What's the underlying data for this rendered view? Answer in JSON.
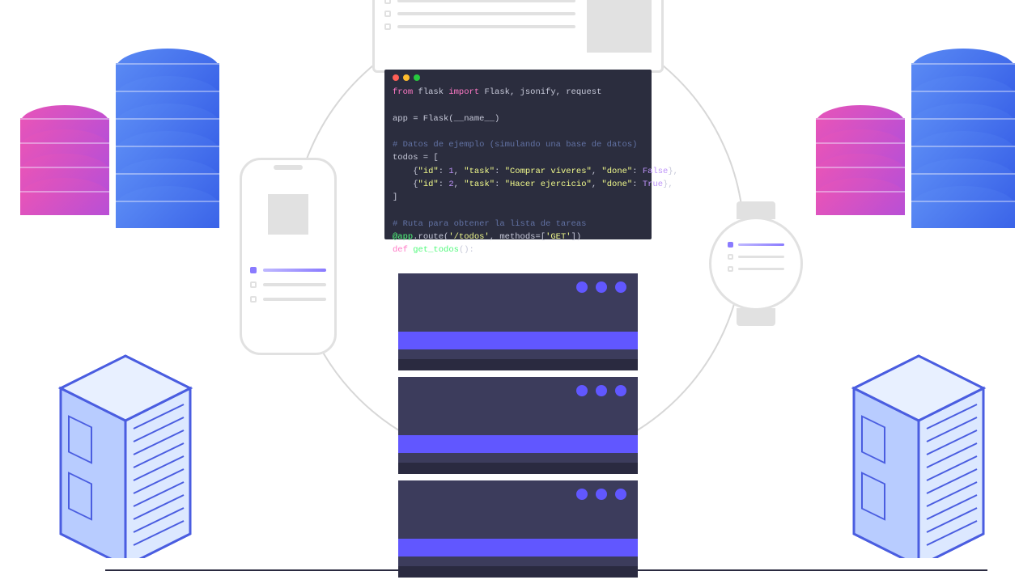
{
  "code": {
    "line1": {
      "from": "from",
      "mod": " flask ",
      "imp": "import",
      "rest": " Flask, jsonify, request"
    },
    "line2": "app = Flask(__name__)",
    "comment1": "# Datos de ejemplo (simulando una base de datos)",
    "line3": "todos = [",
    "line4a": "    {",
    "line4_id": "\"id\"",
    "line4_1": ": ",
    "line4_num": "1",
    "line4_2": ", ",
    "line4_task": "\"task\"",
    "line4_3": ": ",
    "line4_str": "\"Comprar víveres\"",
    "line4_4": ", ",
    "line4_done": "\"done\"",
    "line4_5": ": ",
    "line4_bool": "False",
    "line4_6": "},",
    "line5a": "    {",
    "line5_id": "\"id\"",
    "line5_1": ": ",
    "line5_num": "2",
    "line5_2": ", ",
    "line5_task": "\"task\"",
    "line5_3": ": ",
    "line5_str": "\"Hacer ejercicio\"",
    "line5_4": ", ",
    "line5_done": "\"done\"",
    "line5_5": ": ",
    "line5_bool": "True",
    "line5_6": "},",
    "line6": "]",
    "comment2": "# Ruta para obtener la lista de tareas",
    "decorator_at": "@app",
    "decorator_rest": ".route(",
    "decorator_path": "'/todos'",
    "decorator_m": ", methods=[",
    "decorator_get": "'GET'",
    "decorator_end": "])",
    "def": "def ",
    "fn_name": "get_todos",
    "fn_rest": "():"
  }
}
